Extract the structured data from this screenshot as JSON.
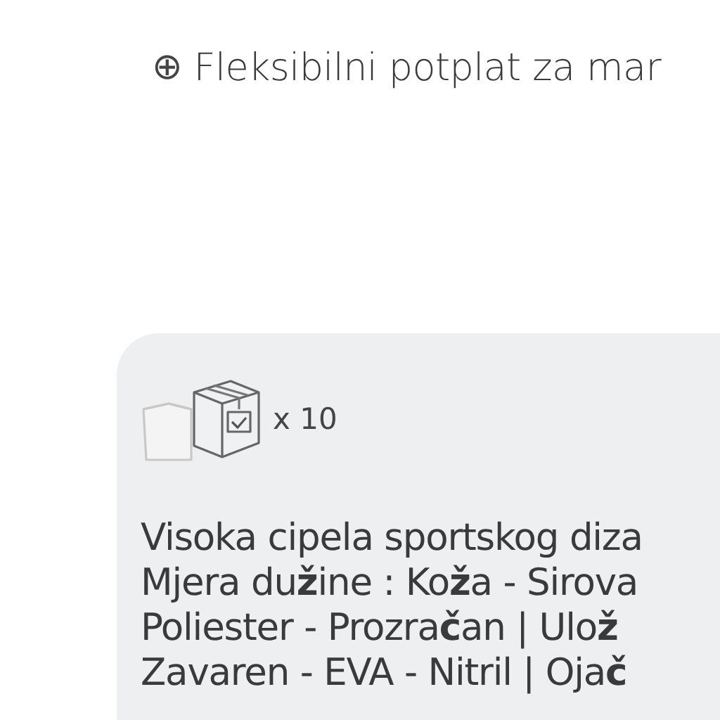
{
  "feature": {
    "symbol": "⊕",
    "text": "Fleksibilni potplat za mar"
  },
  "package": {
    "quantity": "x 10"
  },
  "description_lines": [
    "Visoka cipela sportskog diza",
    "Mjera du**ž**ine : Ko**ž**a - Sirova",
    "Poliester - Prozra**č**an | Ulo**ž**",
    "Zavaren - EVA - Nitril | Oja**č**"
  ]
}
